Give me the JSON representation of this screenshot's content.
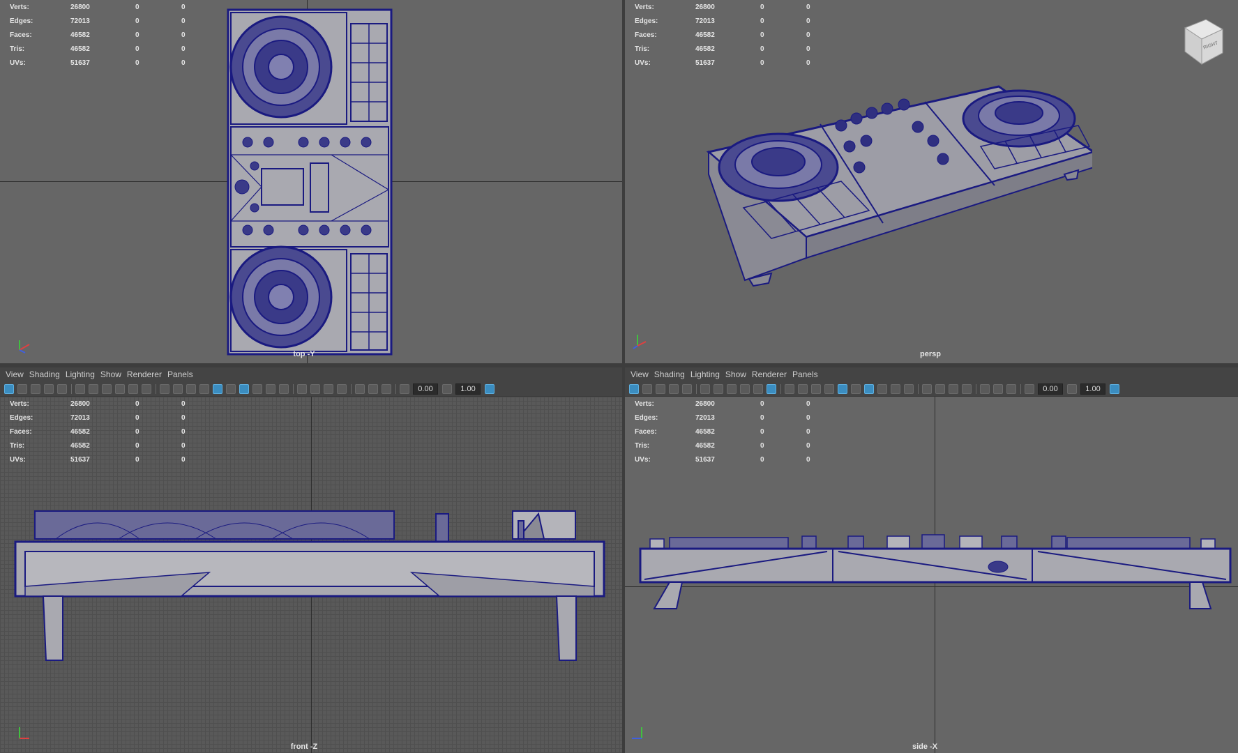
{
  "hud_stats": [
    {
      "label": "Verts:",
      "v1": "26800",
      "v2": "0",
      "v3": "0"
    },
    {
      "label": "Edges:",
      "v1": "72013",
      "v2": "0",
      "v3": "0"
    },
    {
      "label": "Faces:",
      "v1": "46582",
      "v2": "0",
      "v3": "0"
    },
    {
      "label": "Tris:",
      "v1": "46582",
      "v2": "0",
      "v3": "0"
    },
    {
      "label": "UVs:",
      "v1": "51637",
      "v2": "0",
      "v3": "0"
    }
  ],
  "menu": {
    "view": "View",
    "shading": "Shading",
    "lighting": "Lighting",
    "show": "Show",
    "renderer": "Renderer",
    "panels": "Panels"
  },
  "toolbar": {
    "exposure": "0.00",
    "gamma": "1.00"
  },
  "cameras": {
    "top": "top -Y",
    "persp": "persp",
    "front": "front -Z",
    "side": "side -X"
  },
  "viewcube_label": "RIGHT",
  "colors": {
    "viewport_bg": "#666666",
    "wire": "#1a1a80",
    "mesh_fill": "#a9a9b0",
    "panel_bg": "#444444"
  }
}
